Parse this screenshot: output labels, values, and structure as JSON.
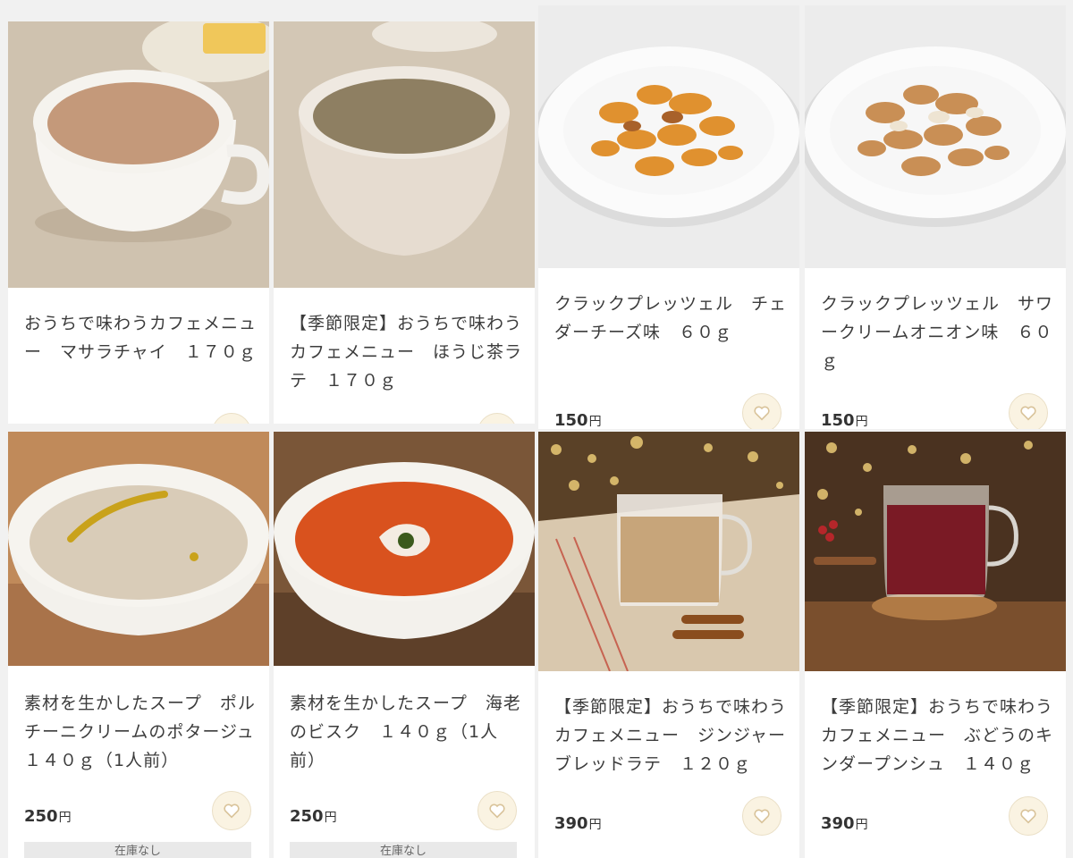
{
  "currency": "円",
  "products": [
    {
      "name": "おうちで味わうカフェメニュー　マサラチャイ　１７０ｇ",
      "price": "",
      "image": "masala-chai-cup"
    },
    {
      "name": "【季節限定】おうちで味わうカフェメニュー　ほうじ茶ラテ　１７０ｇ",
      "price": "",
      "image": "hojicha-latte-cup"
    },
    {
      "name": "クラックプレッツェル　チェダーチーズ味　６０ｇ",
      "price": "150",
      "image": "cheddar-pretzel-plate"
    },
    {
      "name": "クラックプレッツェル　サワークリームオニオン味　６０ｇ",
      "price": "150",
      "image": "sour-cream-pretzel-plate"
    },
    {
      "name": "素材を生かしたスープ　ポルチーニクリームのポタージュ　１４０ｇ（1人前）",
      "price": "250",
      "image": "porcini-potage-bowl",
      "stock": "在庫なし"
    },
    {
      "name": "素材を生かしたスープ　海老のビスク　１４０ｇ（1人前）",
      "price": "250",
      "image": "shrimp-bisque-bowl",
      "stock": "在庫なし"
    },
    {
      "name": "【季節限定】おうちで味わうカフェメニュー　ジンジャーブレッドラテ　１２０ｇ",
      "price": "390",
      "image": "gingerbread-latte-mug"
    },
    {
      "name": "【季節限定】おうちで味わうカフェメニュー　ぶどうのキンダープンシュ　１４０ｇ",
      "price": "390",
      "image": "grape-kinderpunsch-mug"
    }
  ],
  "colors": {
    "favorite_bg": "#faf3e2",
    "favorite_icon": "#d9c39a",
    "page_bg": "#f1f1f1"
  },
  "icons": {
    "favorite": "heart-icon"
  }
}
